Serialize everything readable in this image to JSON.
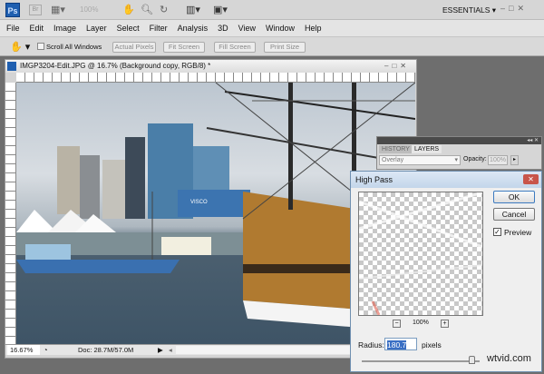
{
  "app": {
    "logo": "Ps",
    "bridge": "Br",
    "zoom": "100%",
    "workspace": "ESSENTIALS"
  },
  "menu": [
    "File",
    "Edit",
    "Image",
    "Layer",
    "Select",
    "Filter",
    "Analysis",
    "3D",
    "View",
    "Window",
    "Help"
  ],
  "options": {
    "scroll_all": "Scroll All Windows",
    "actual_pixels": "Actual Pixels",
    "fit_screen": "Fit Screen",
    "fill_screen": "Fill Screen",
    "print_size": "Print Size"
  },
  "document": {
    "title": "IMGP3204-Edit.JPG @ 16.7% (Background copy, RGB/8) *",
    "zoom": "16.67%",
    "doc_info": "Doc: 28.7M/57.0M",
    "watermark_sign": "VISCO SHARE"
  },
  "panel": {
    "tabs": [
      "HISTORY",
      "LAYERS"
    ],
    "blend_mode": "Overlay",
    "opacity_label": "Opacity:",
    "opacity": "100%"
  },
  "dialog": {
    "title": "High Pass",
    "ok": "OK",
    "cancel": "Cancel",
    "preview": "Preview",
    "preview_checked": true,
    "zoom": "100%",
    "radius_label": "Radius:",
    "radius": "180.7",
    "units": "pixels",
    "slider_fraction": 0.94
  },
  "watermark": "wtvid.com"
}
